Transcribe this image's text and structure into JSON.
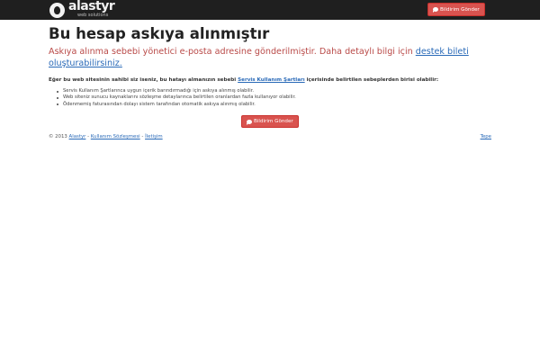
{
  "navbar": {
    "brand_name": "alastyr",
    "brand_tagline": "web solutions",
    "notify_button_label": "Bildirim Gönder",
    "notify_icon": "comment-icon"
  },
  "main": {
    "title": "Bu hesap askıya alınmıştır",
    "lead_text": "Askıya alınma sebebi yönetici e-posta adresine gönderilmiştir. Daha detaylı bilgi için ",
    "lead_link": "destek bileti oluşturabilirsiniz.",
    "info_before": "Eğer bu web sitesinin sahibi siz iseniz, bu hatayı almanızın sebebi ",
    "info_link": "Servis Kullanım Şartları",
    "info_after": " içerisinde belirtilen sebeplerden birisi olabilir:",
    "reasons": [
      "Servis Kullanım Şartlarınca uygun içerik barındırmadığı için askıya alınmış olabilir.",
      "Web siteniz sunucu kaynaklarını sözleşme detaylarınca belirtilen oranlardan fazla kullanıyor olabilir.",
      "Ödenmemiş faturasından dolayı sistem tarafından otomatik askıya alınmış olabilir."
    ],
    "notify_button_label": "Bildirim Gönder"
  },
  "footer": {
    "copyright": "© 2013",
    "links": [
      "Alastyr",
      "Kullanım Sözleşmesi",
      "İletişim"
    ],
    "separator": "-",
    "top_link": "Tepe"
  },
  "colors": {
    "navbar_bg": "#1f1f1f",
    "button_danger": "#d9534f",
    "lead_text": "#b94a48",
    "link": "#2a6ab8"
  }
}
